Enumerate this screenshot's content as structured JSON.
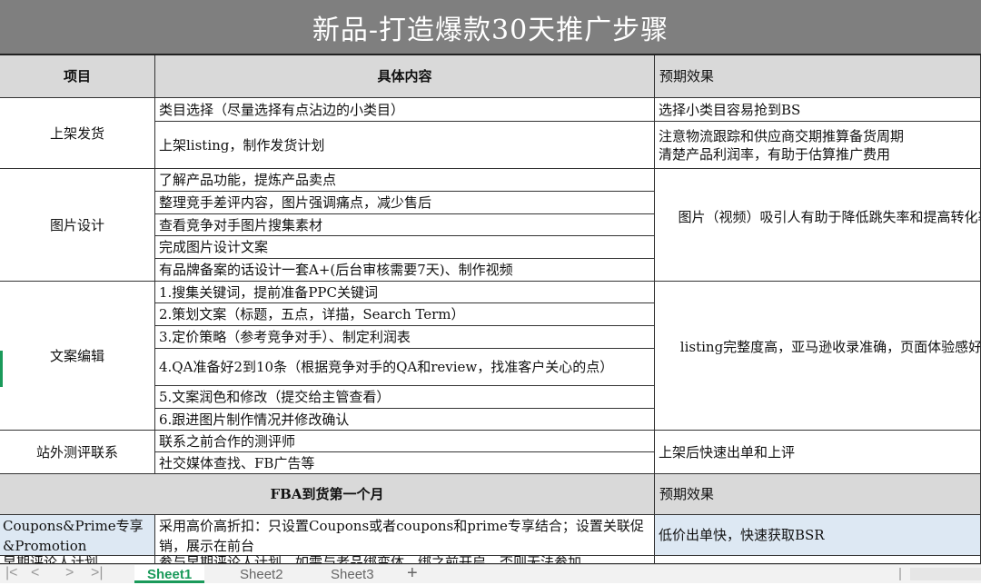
{
  "title": "新品-打造爆款30天推广步骤",
  "header": {
    "col1": "项目",
    "col2": "具体内容",
    "col3": "预期效果"
  },
  "rows": {
    "shangjia": {
      "label": "上架发货",
      "items": [
        "类目选择（尽量选择有点沾边的小类目）",
        "上架listing，制作发货计划"
      ],
      "effect1": "选择小类目容易抢到BS",
      "effect2a": "注意物流跟踪和供应商交期推算备货周期",
      "effect2b": "清楚产品利润率，有助于估算推广费用"
    },
    "tupian": {
      "label": "图片设计",
      "items": [
        "了解产品功能，提炼产品卖点",
        "整理竞手差评内容，图片强调痛点，减少售后",
        "查看竞争对手图片搜集素材",
        "完成图片设计文案",
        "有品牌备案的话设计一套A+(后台审核需要7天)、制作视频"
      ],
      "effect": "图片（视频）吸引人有助于降低跳失率和提高转化率"
    },
    "wenan": {
      "label": "文案编辑",
      "items": [
        "1.搜集关键词，提前准备PPC关键词",
        "2.策划文案（标题，五点，详描，Search Term）",
        "3.定价策略（参考竞争对手）、制定利润表",
        "4.QA准备好2到10条（根据竞争对手的QA和review，找准客户关心的点）",
        "5.文案润色和修改（提交给主管查看）",
        "6.跟进图片制作情况并修改确认"
      ],
      "effect": "listing完整度高，亚马逊收录准确，页面体验感好"
    },
    "zhanwai": {
      "label": "站外测评联系",
      "items": [
        "联系之前合作的测评师",
        "社交媒体查找、FB广告等"
      ],
      "effect": "上架后快速出单和上评"
    }
  },
  "section2": {
    "title": "FBA到货第一个月",
    "effect_header": "预期效果"
  },
  "coupons": {
    "label": "Coupons&Prime专享&Promotion",
    "content": "采用高价高折扣：只设置Coupons或者coupons和prime专享结合；设置关联促销，展示在前台",
    "effect": "低价出单快，快速获取BSR"
  },
  "partial_row": {
    "label": "早期评论人计划",
    "content": "参与早期评论人计划，如需与老品绑变体，绑之前开启，否则无法参加"
  },
  "tabs": [
    "Sheet1",
    "Sheet2",
    "Sheet3"
  ],
  "add_tab": "+",
  "nav": {
    "first": "|<",
    "prev": "<",
    "next": ">",
    "last": ">|"
  }
}
